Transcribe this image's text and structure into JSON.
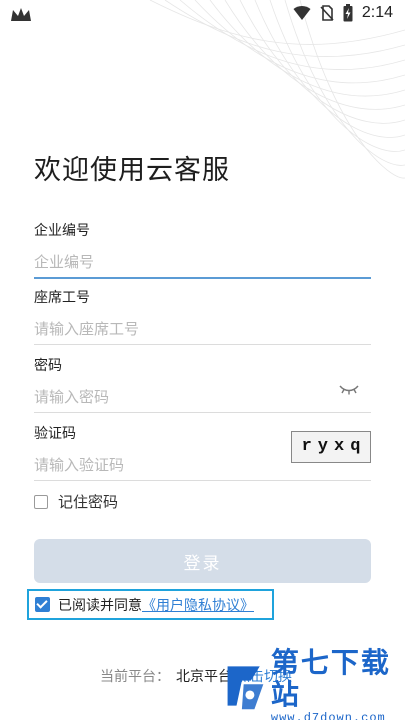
{
  "status_bar": {
    "time": "2:14",
    "icons": [
      "crown-icon",
      "wifi-icon",
      "no-sim-icon",
      "battery-charging-icon"
    ]
  },
  "login": {
    "title": "欢迎使用云客服",
    "company": {
      "label": "企业编号",
      "placeholder": "企业编号",
      "value": ""
    },
    "seat": {
      "label": "座席工号",
      "placeholder": "请输入座席工号",
      "value": ""
    },
    "password": {
      "label": "密码",
      "placeholder": "请输入密码",
      "value": "",
      "toggle_icon": "eye-closed-icon"
    },
    "captcha": {
      "label": "验证码",
      "placeholder": "请输入验证码",
      "value": "",
      "image_text": "ryxq"
    },
    "remember": {
      "label": "记住密码",
      "checked": false
    },
    "submit_label": "登录",
    "agreement": {
      "checked": true,
      "text": "已阅读并同意",
      "link": "《用户隐私协议》"
    },
    "platform": {
      "prefix": "当前平台：",
      "name": "北京平台",
      "switch_label": "点击切换"
    }
  },
  "watermark": {
    "title": "第七下载站",
    "url": "www.d7down.com"
  },
  "colors": {
    "accent": "#2f7fd4",
    "button_disabled": "#d4dde8",
    "highlight_border": "#1fa3dc",
    "watermark": "#1c66c9"
  }
}
